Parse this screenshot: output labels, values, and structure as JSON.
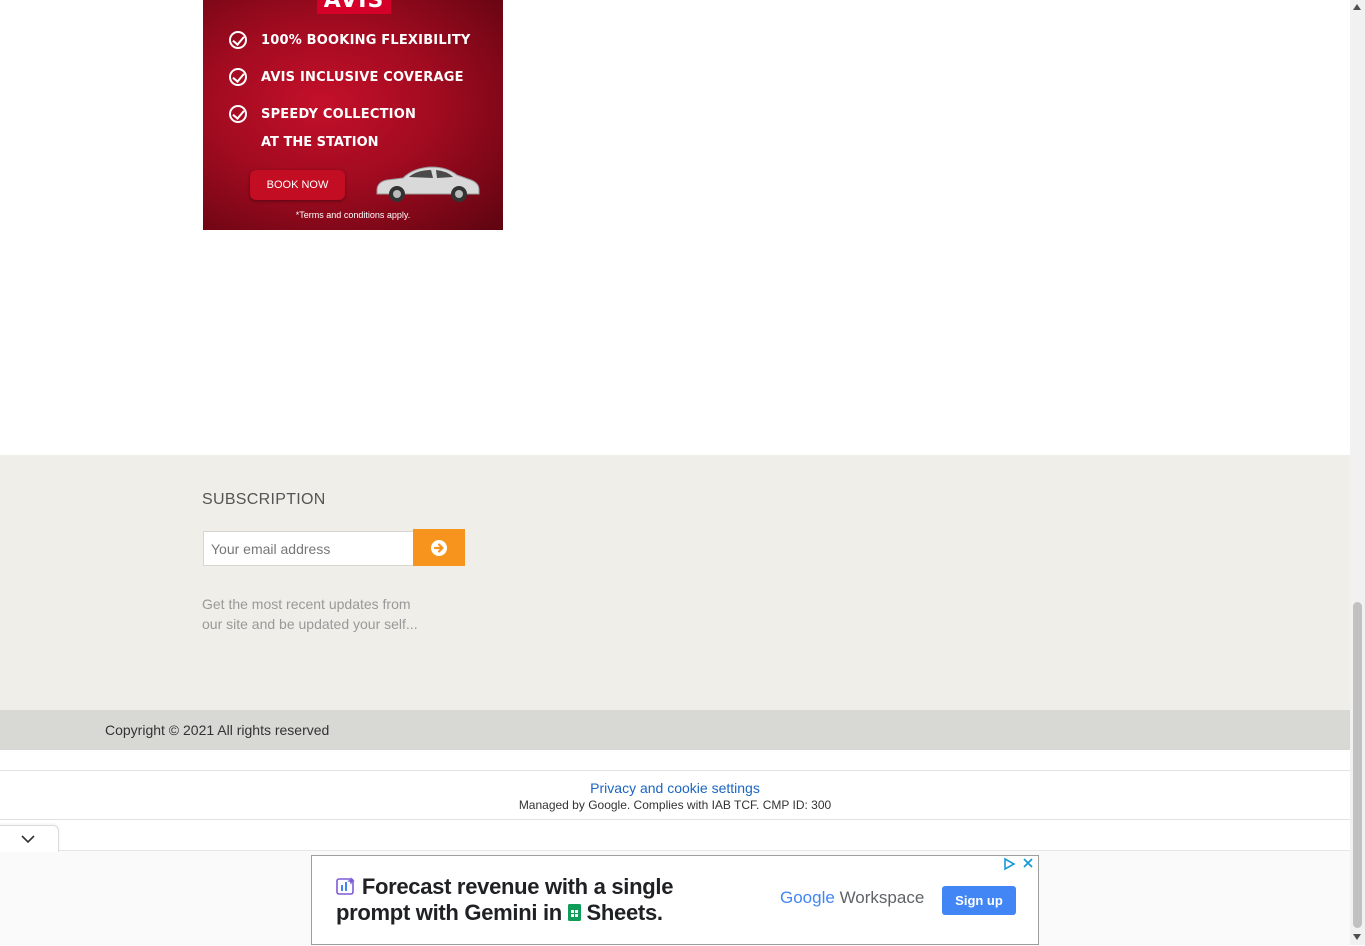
{
  "ad_banner": {
    "brand": "AVIS",
    "features": [
      "100% BOOKING FLEXIBILITY",
      "AVIS INCLUSIVE COVERAGE",
      "SPEEDY COLLECTION"
    ],
    "feature_continuation": "AT THE STATION",
    "cta": "BOOK NOW",
    "terms": "*Terms and conditions apply."
  },
  "subscription": {
    "title": "SUBSCRIPTION",
    "email_placeholder": "Your email address",
    "description": "Get the most recent updates from our site and be updated your self..."
  },
  "footer": {
    "copyright": "Copyright © 2021 All rights reserved"
  },
  "consent": {
    "link": "Privacy and cookie settings",
    "managed_by": "Managed by Google. Complies with IAB TCF. CMP ID: 300"
  },
  "google_ad": {
    "headline_line1": "Forecast revenue with a single",
    "headline_line2_a": "prompt with Gemini in",
    "headline_line2_b": "Sheets.",
    "logo_google": "Google",
    "logo_product": "Workspace",
    "cta": "Sign up"
  },
  "colors": {
    "avis_red": "#c4102a",
    "subscribe_orange": "#f7941d",
    "footer_bg": "#efeee8",
    "copyright_bg": "#d8d8d4",
    "link_blue": "#1a66c2",
    "google_blue": "#4285f4"
  }
}
